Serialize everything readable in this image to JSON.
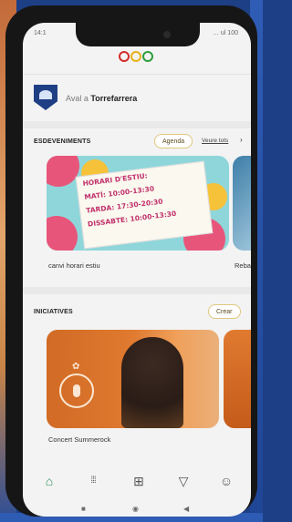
{
  "status_bar": {
    "time": "14:1",
    "right": "… ul 100"
  },
  "header": {
    "town_prefix": "Aval a",
    "town_name": "Torrefarrera"
  },
  "events": {
    "title": "ESDEVENIMENTS",
    "agenda_label": "Agenda",
    "see_all_label": "Veure tots",
    "cards": [
      {
        "image_text": [
          "HORARI D'ESTIU:",
          "MATÍ: 10:00-13:30",
          "TARDA: 17:30-20:30",
          "DISSABTE: 10:00-13:30"
        ],
        "caption": "canvi horari estiu"
      },
      {
        "caption": "Reba"
      }
    ]
  },
  "initiatives": {
    "title": "INICIATIVES",
    "create_label": "Crear",
    "cards": [
      {
        "caption": "Concert Summerock"
      }
    ]
  },
  "tab_bar": {
    "items": [
      {
        "icon": "home-icon",
        "glyph": "⌂"
      },
      {
        "icon": "grid-icon",
        "glyph": "⁞⁞⁞"
      },
      {
        "icon": "add-icon",
        "glyph": "⊞"
      },
      {
        "icon": "send-icon",
        "glyph": "▽"
      },
      {
        "icon": "profile-icon",
        "glyph": "☺"
      }
    ]
  },
  "system_nav": {
    "square": "■",
    "home": "◉",
    "back": "◀"
  },
  "colors": {
    "accent": "#2f8f5a",
    "pill_border": "#e0c77d",
    "brand_red": "#d62a2a",
    "brand_yellow": "#e8b018",
    "brand_green": "#2f9e3e"
  }
}
